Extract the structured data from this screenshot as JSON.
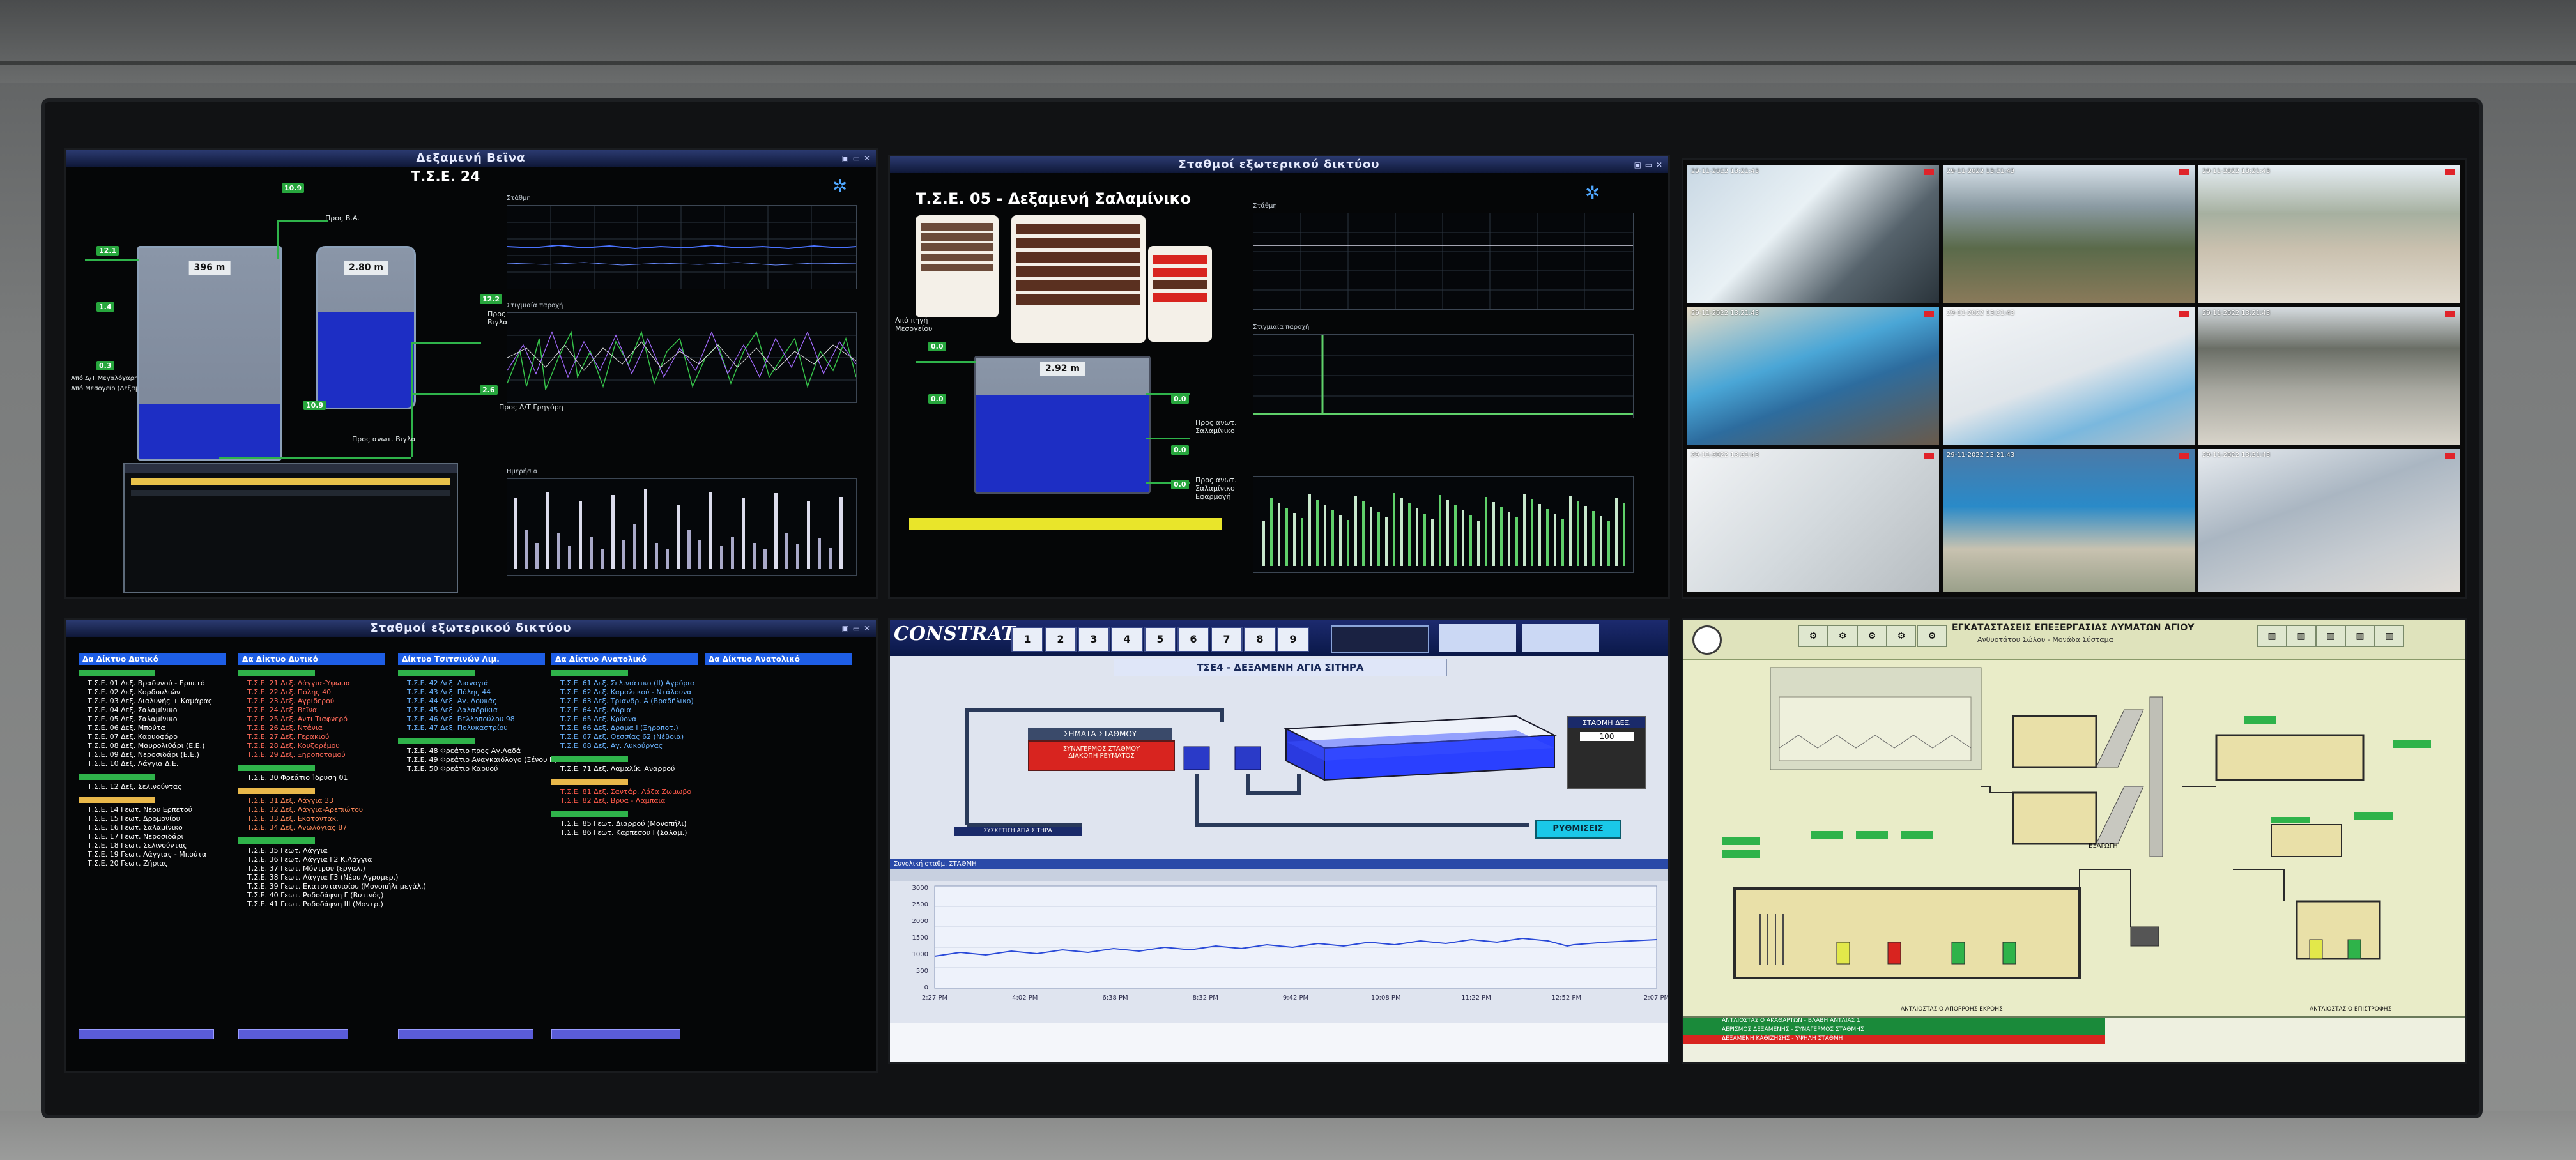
{
  "screens": {
    "tl": {
      "title": "Δεξαμενή Βεϊνα",
      "subtitle": "Τ.Σ.Ε. 24",
      "tank1_value": "396 m",
      "tank2_value": "2.80 m",
      "label_pros_vigla": "Προς Β.Α.",
      "label_pros_ano_vigla": "Προς ανωτ. Βιγλα",
      "label_pros_grigory": "Προς Δ/Τ Γρηγόρη",
      "label_apo_mesogeio": "Από Μεσογείο (Δεξαμενή)",
      "label_apo_anosi": "Από Δ/Τ Μεγαλόχαρη",
      "trend1_title": "Στάθμη",
      "trend2_title": "Στιγμιαία παροχή",
      "trend3_title": "Ημερήσια"
    },
    "tc": {
      "title": "Σταθμοί εξωτερικού δικτύου",
      "subtitle": "Τ.Σ.Ε. 05 - Δεξαμενή Σαλαμίνικο",
      "tank_value": "2.92 m",
      "label_apo_mesogeio": "Από πηγή Μεσογείου",
      "label_pros_salaminiko": "Προς ανωτ. Σαλαμίνικο",
      "label_pros_ano": "Προς ανωτ. Σαλαμίνικο Εφαρμογή",
      "trend1_title": "Στάθμη",
      "trend2_title": "Στιγμιαία παροχή"
    },
    "bl": {
      "title": "Σταθμοί εξωτερικού δικτύου",
      "columns": [
        {
          "head": "Δα Δίκτυο Δυτικό",
          "groups": [
            {
              "items": [
                "Τ.Σ.Ε. 01 Δεξ. Βραδυνού - Ερπετό",
                "Τ.Σ.Ε. 02 Δεξ. Κορδουλιών",
                "Τ.Σ.Ε. 03 Δεξ. Διαλυνής + Καμάρας",
                "Τ.Σ.Ε. 04 Δεξ. Σαλαμίνικο",
                "Τ.Σ.Ε. 05 Δεξ. Σαλαμίνικο",
                "Τ.Σ.Ε. 06 Δεξ. Μπούτα",
                "Τ.Σ.Ε. 07 Δεξ. Καρυοφόρο",
                "Τ.Σ.Ε. 08 Δεξ. Μαυρολιθάρι (Ε.Ε.)",
                "Τ.Σ.Ε. 09 Δεξ. Νεροσιδάρι (Ε.Ε.)",
                "Τ.Σ.Ε. 10 Δεξ. Λάγγια Δ.Ε."
              ]
            },
            {
              "items": [
                "Τ.Σ.Ε. 12 Δεξ. Σελινούντας"
              ]
            },
            {
              "items": [
                "Τ.Σ.Ε. 14 Γεωτ. Νέου Ερπετού",
                "Τ.Σ.Ε. 15 Γεωτ. Δρομονίου",
                "Τ.Σ.Ε. 16 Γεωτ. Σαλαμίνικο",
                "Τ.Σ.Ε. 17 Γεωτ. Νεροσιδάρι",
                "Τ.Σ.Ε. 18 Γεωτ. Σελινούντας",
                "Τ.Σ.Ε. 19 Γεωτ. Λάγγιας - Μπούτα",
                "Τ.Σ.Ε. 20 Γεωτ. Ζήριας"
              ]
            }
          ]
        },
        {
          "head": "Δα Δίκτυο Δυτικό",
          "groups": [
            {
              "items": [
                "Τ.Σ.Ε. 21 Δεξ. Λάγγια-Ύψωμα",
                "Τ.Σ.Ε. 22 Δεξ. Πόλης 40",
                "Τ.Σ.Ε. 23 Δεξ. Αγριδερού",
                "Τ.Σ.Ε. 24 Δεξ. Βεϊνα",
                "Τ.Σ.Ε. 25 Δεξ. Αντι Τιαφνερό",
                "Τ.Σ.Ε. 26 Δεξ. Ντάνια",
                "Τ.Σ.Ε. 27 Δεξ. Γερακιού",
                "Τ.Σ.Ε. 28 Δεξ. Κουζορέμου",
                "Τ.Σ.Ε. 29 Δεξ. Ξηροποταμού"
              ]
            },
            {
              "items": [
                "Τ.Σ.Ε. 30 Φρεάτιο Ίδρυση 01"
              ]
            },
            {
              "items": [
                "Τ.Σ.Ε. 31 Δεξ. Λάγγια 33",
                "Τ.Σ.Ε. 32 Δεξ. Λάγγια-Αρεπιώτου",
                "Τ.Σ.Ε. 33 Δεξ. Εκατοντακ.",
                "Τ.Σ.Ε. 34 Δεξ. Ανωλόγιας 87"
              ]
            },
            {
              "items": [
                "Τ.Σ.Ε. 35 Γεωτ. Λάγγια",
                "Τ.Σ.Ε. 36 Γεωτ. Λάγγια Γ2 Κ.Λάγγια",
                "Τ.Σ.Ε. 37 Γεωτ. Μόντρου (εργαλ.)",
                "Τ.Σ.Ε. 38 Γεωτ. Λάγγια Γ3 (Νέου Αγρομερ.)",
                "Τ.Σ.Ε. 39 Γεωτ. Εκατοντανισίου (Μονοπήλι μεγάλ.)",
                "Τ.Σ.Ε. 40 Γεωτ. Ροδοδάφνη Γ (Βυτινός)",
                "Τ.Σ.Ε. 41 Γεωτ. Ροδοδάφνη ΙΙΙ (Μοντρ.)"
              ]
            }
          ]
        },
        {
          "head": "Δίκτυο Τσιτσινών Λιμ.",
          "groups": [
            {
              "items": [
                "Τ.Σ.Ε. 42 Δεξ. Λιανογιά",
                "Τ.Σ.Ε. 43 Δεξ. Πόλης 44",
                "Τ.Σ.Ε. 44 Δεξ. Αγ. Λουκάς",
                "Τ.Σ.Ε. 45 Δεξ. Λαλαδρίκια",
                "Τ.Σ.Ε. 46 Δεξ. Βελλοπούλου 98",
                "Τ.Σ.Ε. 47 Δεξ. Πολυκαστρίου"
              ]
            },
            {
              "items": [
                "Τ.Σ.Ε. 48 Φρεάτιο προς Αγ.Λαδά",
                "Τ.Σ.Ε. 49 Φρεάτιο Αναγκαιόλογο (Ξένου Βράσια)",
                "Τ.Σ.Ε. 50 Φρεάτιο Καρυού"
              ]
            }
          ]
        },
        {
          "head": "Δα Δίκτυο Ανατολικό",
          "groups": [
            {
              "items": [
                "Τ.Σ.Ε. 61 Δεξ. Σελινιάτικο (ΙΙ) Αγρόρια",
                "Τ.Σ.Ε. 62 Δεξ. Καμαλεκού - Ντάλουνα",
                "Τ.Σ.Ε. 63 Δεξ. Τριανδρ. Α (Βραδήλικο)",
                "Τ.Σ.Ε. 64 Δεξ. Λόρια",
                "Τ.Σ.Ε. 65 Δεξ. Κρύονα",
                "Τ.Σ.Ε. 66 Δεξ. Δραμα Ι (Ξηροποτ.)",
                "Τ.Σ.Ε. 67 Δεξ. Θεσσίας 62 (Νέβοια)",
                "Τ.Σ.Ε. 68 Δεξ. Αγ. Λυκούργας"
              ]
            },
            {
              "items": [
                "Τ.Σ.Ε. 71 Δεξ. Λαμαλίκ. Αναρρού"
              ]
            },
            {
              "items": [
                "Τ.Σ.Ε. 81 Δεξ. Σαντάρ. Λάζα Ζωμωβο",
                "Τ.Σ.Ε. 82 Δεξ. Βρυα - Λαμπαια"
              ]
            },
            {
              "items": [
                "Τ.Σ.Ε. 85 Γεωτ. Διαρρού (Μονοπήλι)",
                "Τ.Σ.Ε. 86 Γεωτ. Καρπεσου Ι (Σαλαμ.)"
              ]
            }
          ]
        },
        {
          "head": "Δα Δίκτυο Ανατολικό",
          "groups": []
        }
      ]
    },
    "bc": {
      "logo": "CONSTRAT",
      "nav_buttons": [
        "1",
        "2",
        "3",
        "4",
        "5",
        "6",
        "7",
        "8",
        "9"
      ],
      "title": "ΤΣΕ4 - ΔΕΞΑΜΕΝΗ ΑΓΙΑ ΣΙΤΗΡΑ",
      "alarm_title": "ΣΗΜΑΤΑ ΣΤΑΘΜΟΥ",
      "alarm_line1": "ΣΥΝΑΓΕΡΜΟΣ ΣΤΑΘΜΟΥ",
      "alarm_line2": "ΔΙΑΚΟΠΗ ΡΕΥΜΑΤΟΣ",
      "panel_title": "ΣΤΑΘΜΗ ΔΕΞ.",
      "panel_value": "100",
      "button_label": "ΡΥΘΜΙΣΕΙΣ",
      "pipe_label": "ΣΥΣΧΕΤΙΣΗ ΑΓΙΑ ΣΙΤΗΡΑ",
      "trend_title": "Συνολική σταθμ. ΣΤΑΘΜΗ",
      "time_labels": [
        "2:27 PM",
        "4:02 PM",
        "6:38 PM",
        "8:32 PM",
        "9:42 PM",
        "10:08 PM",
        "11:22 PM",
        "12:52 PM",
        "2:07 PM"
      ],
      "y_labels": [
        "3000",
        "2500",
        "2000",
        "1500",
        "1000",
        "500",
        "0"
      ]
    },
    "br": {
      "title": "ΕΓΚΑΤΑΣΤΑΣΕΙΣ ΕΠΕΞΕΡΓΑΣΙΑΣ ΛΥΜΑΤΩΝ ΑΓΙΟΥ",
      "subtitle": "Ανθυοτάτου Σώλου - Μονάδα Σύσταμα",
      "label_exagogi": "ΕΞΑΓΩΓΗ",
      "alarm_rows": [
        "ΑΝΤΛΙΟΣΤΑΣΙΟ ΑΚΑΘΑΡΤΩΝ - ΒΛΑΒΗ ΑΝΤΛΙΑΣ 1",
        "ΑΕΡΙΣΜΟΣ ΔΕΞΑΜΕΝΗΣ - ΣΥΝΑΓΕΡΜΟΣ ΣΤΑΘΜΗΣ",
        "ΔΕΞΑΜΕΝΗ ΚΑΘΙΖΗΣΗΣ - ΥΨΗΛΗ ΣΤΑΘΜΗ"
      ],
      "footer": "ΑΝΤΛΙΟΣΤΑΣΙΟ ΑΠΟΡΡΟΗΣ ΕΚΡΟΗΣ",
      "footer2": "ΑΝΤΛΙΟΣΤΑΣΙΟ ΕΠΙΣΤΡΟΦΗΣ"
    }
  },
  "colors": {
    "accent_green": "#2fb34a",
    "water_blue": "#1d2ec4",
    "scada_bg": "#e9ecc8",
    "alarm_red": "#d8241f"
  }
}
